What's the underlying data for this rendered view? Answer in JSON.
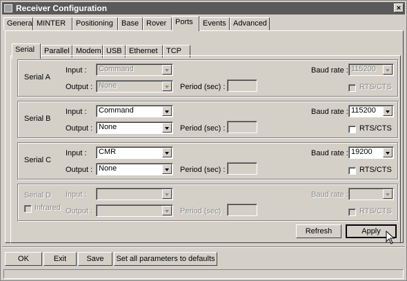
{
  "window": {
    "title": "Receiver Configuration",
    "close_glyph": "×"
  },
  "tabs": [
    "General",
    "MINTER",
    "Positioning",
    "Base",
    "Rover",
    "Ports",
    "Events",
    "Advanced"
  ],
  "active_tab": "Ports",
  "subtabs": [
    "Serial",
    "Parallel",
    "Modem",
    "USB",
    "Ethernet",
    "TCP"
  ],
  "active_subtab": "Serial",
  "labels": {
    "input": "Input :",
    "output": "Output :",
    "period": "Period (sec) :",
    "baud": "Baud rate :",
    "rtscts": "RTS/CTS",
    "infrared": "Infrared"
  },
  "ports": [
    {
      "name": "Serial A",
      "input": "Command",
      "output": "None",
      "baud": "115200",
      "enabled": false
    },
    {
      "name": "Serial B",
      "input": "Command",
      "output": "None",
      "baud": "115200",
      "enabled": true
    },
    {
      "name": "Serial C",
      "input": "CMR",
      "output": "None",
      "baud": "19200",
      "enabled": true
    },
    {
      "name": "Serial D",
      "input": "",
      "output": "",
      "baud": "",
      "enabled": false
    }
  ],
  "panel_buttons": {
    "refresh": "Refresh",
    "apply": "Apply"
  },
  "footer_buttons": {
    "ok": "OK",
    "exit": "Exit",
    "save": "Save",
    "defaults": "Set all parameters to defaults"
  },
  "icons": {
    "close": "close-icon",
    "dropdown": "chevron-down-icon",
    "cursor": "mouse-pointer-icon"
  }
}
